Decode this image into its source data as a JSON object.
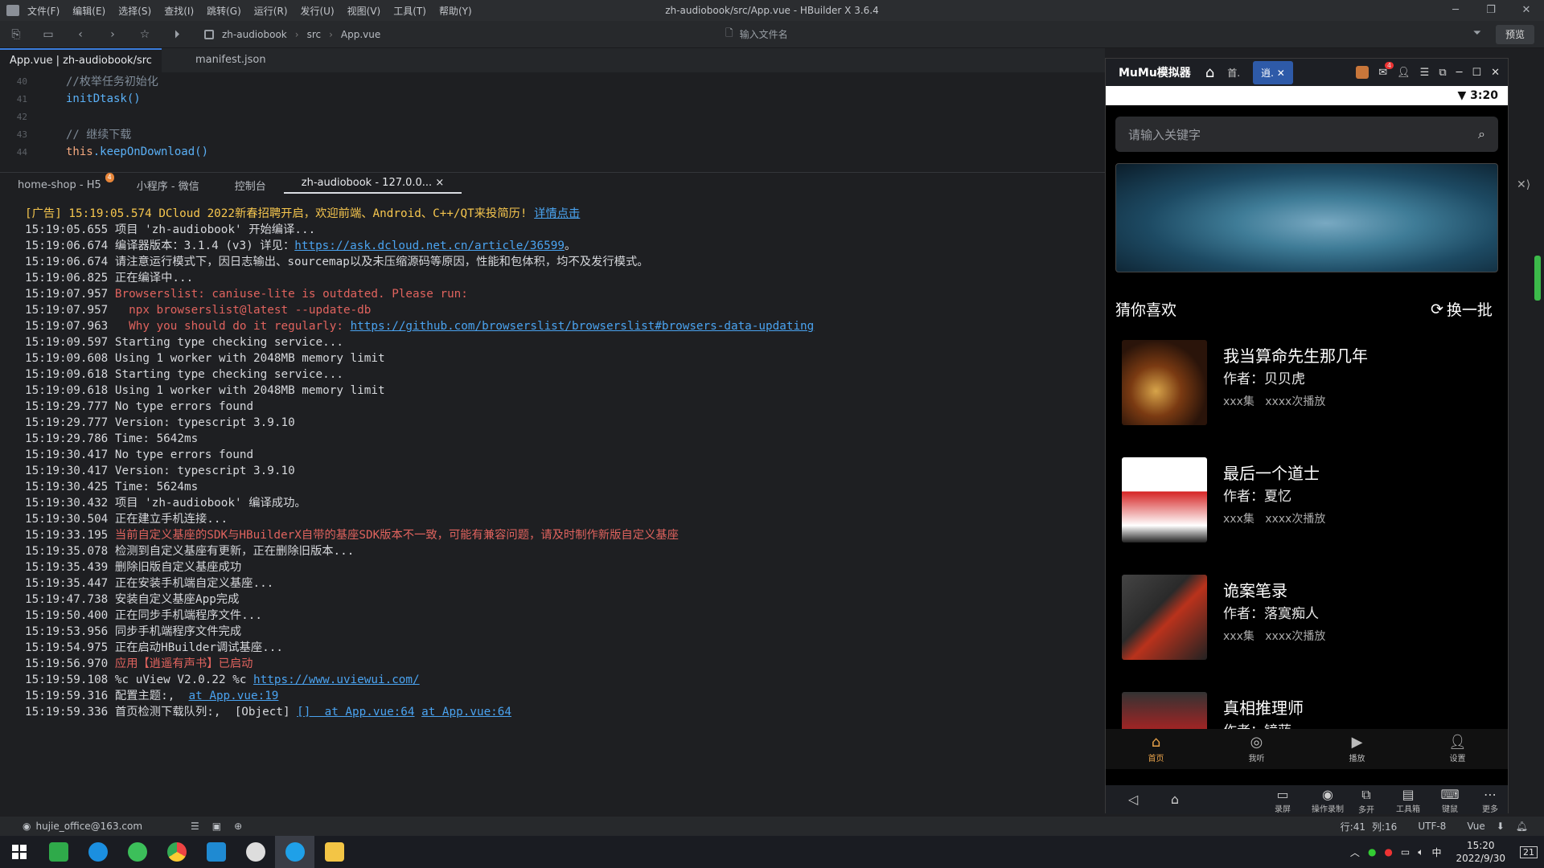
{
  "window": {
    "title": "zh-audiobook/src/App.vue - HBuilder X 3.6.4",
    "menu": [
      "文件(F)",
      "编辑(E)",
      "选择(S)",
      "查找(I)",
      "跳转(G)",
      "运行(R)",
      "发行(U)",
      "视图(V)",
      "工具(T)",
      "帮助(Y)"
    ]
  },
  "toolbar": {
    "breadcrumbs": [
      "zh-audiobook",
      "src",
      "App.vue"
    ],
    "file_search_placeholder": "输入文件名",
    "preview_label": "预览"
  },
  "editor": {
    "tabs": [
      "App.vue | zh-audiobook/src",
      "manifest.json"
    ],
    "lines": [
      {
        "num": "40",
        "text": "//枚举任务初始化"
      },
      {
        "num": "41",
        "text": "initDtask()"
      },
      {
        "num": "42",
        "text": ""
      },
      {
        "num": "43",
        "text": "// 继续下载"
      },
      {
        "num": "44",
        "kw": "this",
        "text": ".keepOnDownload()"
      }
    ]
  },
  "console_tabs": {
    "tabs": [
      "home-shop - H5",
      "小程序 - 微信",
      "控制台",
      "zh-audiobook - 127.0.0..."
    ],
    "badge": "4"
  },
  "console": {
    "ad_prefix": "[广告] 15:19:05.574 DCloud 2022新春招聘开启，欢迎前端、Android、C++/QT来投简历! ",
    "ad_link": "详情点击",
    "logs": [
      {
        "t": "15:19:05.655 项目 'zh-audiobook' 开始编译..."
      },
      {
        "t": "15:19:06.674 编译器版本：3.1.4 (v3) 详见：",
        "link": "https://ask.dcloud.net.cn/article/36599",
        "after": "。"
      },
      {
        "t": "15:19:06.674 请注意运行模式下，因日志输出、sourcemap以及未压缩源码等原因，性能和包体积，均不及发行模式。"
      },
      {
        "t": "15:19:06.825 正在编译中..."
      },
      {
        "t": "15:19:07.957 ",
        "red": "Browserslist: caniuse-lite is outdated. Please run:"
      },
      {
        "t": "15:19:07.957 ",
        "red": "  npx browserslist@latest --update-db"
      },
      {
        "t": "15:19:07.963 ",
        "red": "  Why you should do it regularly: ",
        "link": "https://github.com/browserslist/browserslist#browsers-data-updating"
      },
      {
        "t": "15:19:09.597 Starting type checking service..."
      },
      {
        "t": "15:19:09.608 Using 1 worker with 2048MB memory limit"
      },
      {
        "t": "15:19:09.618 Starting type checking service..."
      },
      {
        "t": "15:19:09.618 Using 1 worker with 2048MB memory limit"
      },
      {
        "t": "15:19:29.777 No type errors found"
      },
      {
        "t": "15:19:29.777 Version: typescript 3.9.10"
      },
      {
        "t": "15:19:29.786 Time: 5642ms"
      },
      {
        "t": "15:19:30.417 No type errors found"
      },
      {
        "t": "15:19:30.417 Version: typescript 3.9.10"
      },
      {
        "t": "15:19:30.425 Time: 5624ms"
      },
      {
        "t": "15:19:30.432 项目 'zh-audiobook' 编译成功。"
      },
      {
        "t": "15:19:30.504 正在建立手机连接..."
      },
      {
        "t": "15:19:33.195 ",
        "red": "当前自定义基座的SDK与HBuilderX自带的基座SDK版本不一致，可能有兼容问题，请及时制作新版自定义基座"
      },
      {
        "t": "15:19:35.078 检测到自定义基座有更新，正在删除旧版本..."
      },
      {
        "t": "15:19:35.439 删除旧版自定义基座成功"
      },
      {
        "t": "15:19:35.447 正在安装手机端自定义基座..."
      },
      {
        "t": "15:19:47.738 安装自定义基座App完成"
      },
      {
        "t": "15:19:50.400 正在同步手机端程序文件..."
      },
      {
        "t": "15:19:53.956 同步手机端程序文件完成"
      },
      {
        "t": "15:19:54.975 正在启动HBuilder调试基座..."
      },
      {
        "t": "15:19:56.970 ",
        "red": "应用【逍遥有声书】已启动"
      },
      {
        "t": "15:19:59.108 %c uView V2.0.22 %c ",
        "link": "https://www.uviewui.com/"
      },
      {
        "t": "15:19:59.316 配置主题:,  ",
        "link": "at App.vue:19"
      },
      {
        "t": "15:19:59.336 首页检测下载队列:,  [Object] ",
        "link": "[]  at App.vue:64",
        "link2": "at App.vue:64"
      }
    ]
  },
  "statusbar": {
    "user": "hujie_office@163.com",
    "row": "行:41",
    "col": "列:16",
    "encoding": "UTF-8",
    "lang": "Vue"
  },
  "emulator": {
    "title": "MuMu模拟器",
    "tab1": "首.",
    "tab2": "逍.",
    "mail_badge": "4",
    "time": "3:20",
    "search_placeholder": "请输入关键字",
    "section_title": "猜你喜欢",
    "refresh_label": "换一批",
    "books": [
      {
        "title": "我当算命先生那几年",
        "author": "作者：贝贝虎",
        "meta": "xxx集   xxxx次播放"
      },
      {
        "title": "最后一个道士",
        "author": "作者：夏忆",
        "meta": "xxx集   xxxx次播放"
      },
      {
        "title": "诡案笔录",
        "author": "作者：落寞痴人",
        "meta": "xxx集   xxxx次播放"
      },
      {
        "title": "真相推理师",
        "author": "作者：镜蓝"
      }
    ],
    "tabs": [
      "首页",
      "我听",
      "播放",
      "设置"
    ],
    "nav": [
      "录屏",
      "操作录制",
      "多开",
      "工具箱",
      "键鼠",
      "更多"
    ]
  },
  "taskbar": {
    "time": "15:20",
    "date": "2022/9/30",
    "ime": "中",
    "notif": "21"
  }
}
